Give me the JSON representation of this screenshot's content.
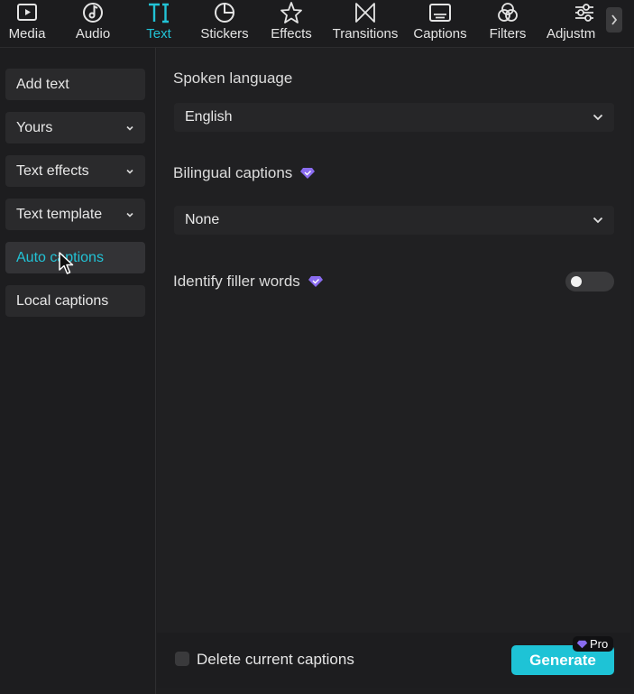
{
  "toolbar": {
    "tabs": [
      {
        "label": "Media",
        "icon": "media-icon"
      },
      {
        "label": "Audio",
        "icon": "audio-icon"
      },
      {
        "label": "Text",
        "icon": "text-icon",
        "active": true
      },
      {
        "label": "Stickers",
        "icon": "stickers-icon"
      },
      {
        "label": "Effects",
        "icon": "effects-icon"
      },
      {
        "label": "Transitions",
        "icon": "transitions-icon"
      },
      {
        "label": "Captions",
        "icon": "captions-icon"
      },
      {
        "label": "Filters",
        "icon": "filters-icon"
      },
      {
        "label": "Adjustm",
        "icon": "adjustment-icon"
      }
    ],
    "accent_color": "#22c3d6"
  },
  "sidebar": {
    "items": [
      {
        "label": "Add text"
      },
      {
        "label": "Yours",
        "expandable": true
      },
      {
        "label": "Text effects",
        "expandable": true
      },
      {
        "label": "Text template",
        "expandable": true
      },
      {
        "label": "Auto captions",
        "active": true
      },
      {
        "label": "Local captions"
      }
    ]
  },
  "main": {
    "spoken_language": {
      "label": "Spoken language",
      "value": "English"
    },
    "bilingual_captions": {
      "label": "Bilingual captions",
      "value": "None",
      "premium": true
    },
    "filler_words": {
      "label": "Identify filler words",
      "premium": true,
      "enabled": false
    }
  },
  "footer": {
    "delete_label": "Delete current captions",
    "delete_checked": false,
    "generate_label": "Generate",
    "pro_label": "Pro",
    "generate_color": "#1ec3d6"
  }
}
